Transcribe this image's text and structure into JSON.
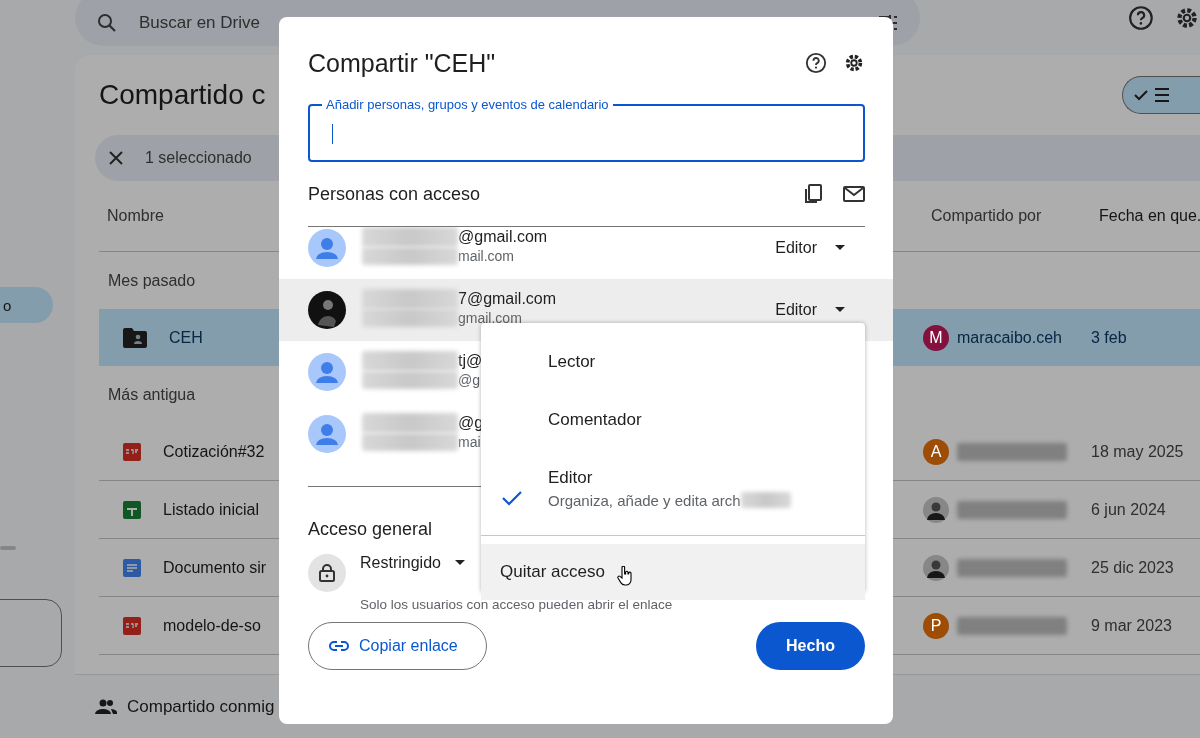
{
  "drive": {
    "search": {
      "placeholder": "Buscar en Drive"
    },
    "view_toggle": {
      "selected": true
    },
    "nav": {
      "label": "o",
      "selected": true
    },
    "title": "Compartido c",
    "selection": {
      "label": "1 seleccionado"
    },
    "columns": [
      "Nombre",
      "Compartido por",
      "Fecha en que."
    ],
    "groups": [
      {
        "label": "Mes pasado",
        "rows": [
          {
            "name": "CEH",
            "kind": "shared-folder",
            "selected": true,
            "sharer": {
              "kind": "letter",
              "initial": "M",
              "color": "#84103e",
              "name": "maracaibo.ceh"
            },
            "date": "3 feb"
          }
        ]
      },
      {
        "label": "Más antigua",
        "rows": [
          {
            "name": "Cotización#32",
            "kind": "pdf",
            "selected": false,
            "sharer": {
              "kind": "letter",
              "initial": "A",
              "color": "#9e4d07"
            },
            "date": "18 may 2025"
          },
          {
            "name": "Listado inicial",
            "kind": "sheet",
            "selected": false,
            "sharer": {
              "kind": "photo"
            },
            "date": "6 jun 2024"
          },
          {
            "name": "Documento sir",
            "kind": "doc",
            "selected": false,
            "sharer": {
              "kind": "photo"
            },
            "date": "25 dic 2023"
          },
          {
            "name": "modelo-de-so",
            "kind": "pdf",
            "selected": false,
            "sharer": {
              "kind": "letter",
              "initial": "P",
              "color": "#9e4d07"
            },
            "date": "9 mar 2023"
          }
        ]
      }
    ],
    "footer": "Compartido conmig"
  },
  "dialog": {
    "title": "Compartir \"CEH\"",
    "add_field": {
      "label": "Añadir personas, grupos y eventos de calendario"
    },
    "people_heading": "Personas con acceso",
    "people": [
      {
        "email": "@gmail.com",
        "sub": "mail.com",
        "kind": "default",
        "role": "Editor",
        "hovered": false
      },
      {
        "email": "7@gmail.com",
        "sub": "gmail.com",
        "kind": "photo",
        "role": "Editor",
        "hovered": true
      },
      {
        "email": "tj@",
        "sub": "@g",
        "kind": "default",
        "hovered": false
      },
      {
        "email": "@g",
        "sub": "mai",
        "kind": "default",
        "hovered": false
      }
    ],
    "general_heading": "Acceso general",
    "access": {
      "label": "Restringido",
      "description": "Solo los usuarios con acceso pueden abrir el enlace"
    },
    "copy_link": "Copiar enlace",
    "done": "Hecho"
  },
  "menu": {
    "items": [
      {
        "label": "Lector",
        "selected": false
      },
      {
        "label": "Comentador",
        "selected": false
      },
      {
        "label": "Editor",
        "selected": true,
        "description": "Organiza, añade y edita arch"
      }
    ],
    "remove": {
      "label": "Quitar acceso",
      "hovered": true
    }
  }
}
